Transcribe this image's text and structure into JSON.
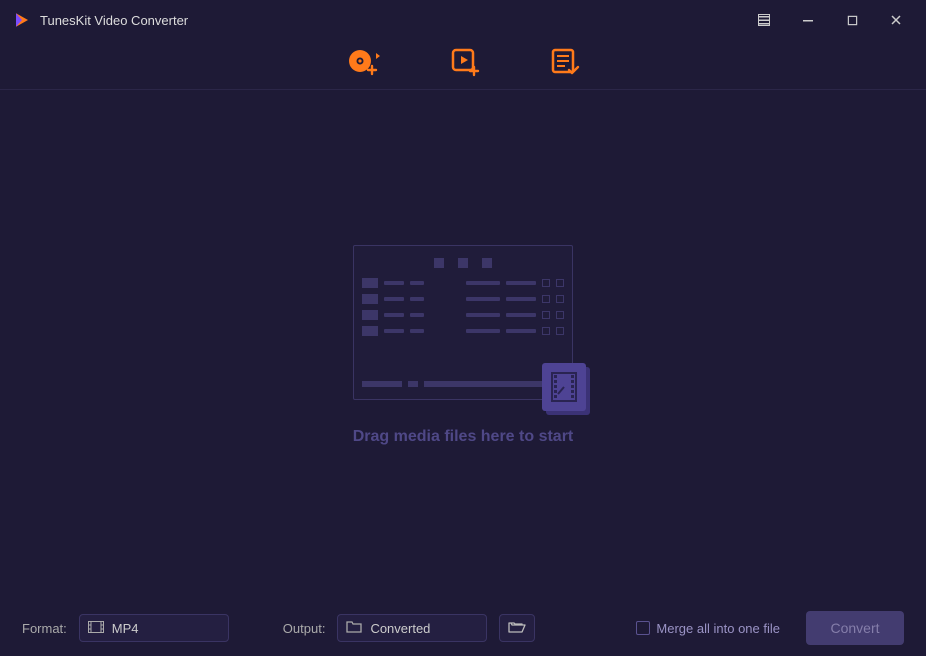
{
  "titlebar": {
    "title": "TunesKit Video Converter"
  },
  "toolbar": {
    "buttons": [
      {
        "name": "add-disc",
        "icon": "disc-plus"
      },
      {
        "name": "add-file",
        "icon": "video-file-plus"
      },
      {
        "name": "list",
        "icon": "list-check"
      }
    ]
  },
  "dropzone": {
    "hint": "Drag media files here to start"
  },
  "bottombar": {
    "format_label": "Format:",
    "format_value": "MP4",
    "output_label": "Output:",
    "output_value": "Converted",
    "merge_label": "Merge all into one file",
    "convert_label": "Convert"
  }
}
